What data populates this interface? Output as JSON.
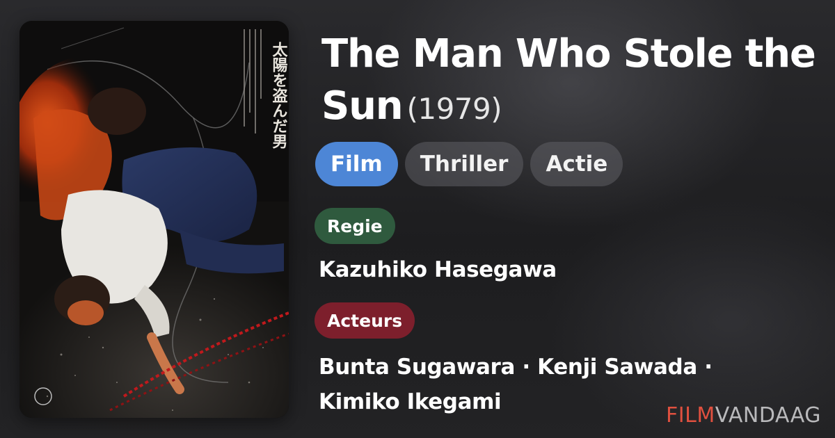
{
  "movie": {
    "title": "The Man Who Stole the Sun",
    "year": "(1979)"
  },
  "genres": [
    "Film",
    "Thriller",
    "Actie"
  ],
  "credits": {
    "director_label": "Regie",
    "director": "Kazuhiko Hasegawa",
    "actors_label": "Acteurs",
    "actors": "Bunta Sugawara · Kenji Sawada · Kimiko Ikegami"
  },
  "logo": {
    "part1": "FILM",
    "part2": "VANDAAG"
  },
  "poster": {
    "japanese_title": "太陽を盗んだ男"
  },
  "colors": {
    "genre_primary": "#4d86d6",
    "genre_chip": "#5f5f64",
    "director_badge": "#2f5a3e",
    "actors_badge": "#7d1f2c",
    "logo_accent": "#e0503f",
    "logo_secondary": "#b9b9bb"
  }
}
